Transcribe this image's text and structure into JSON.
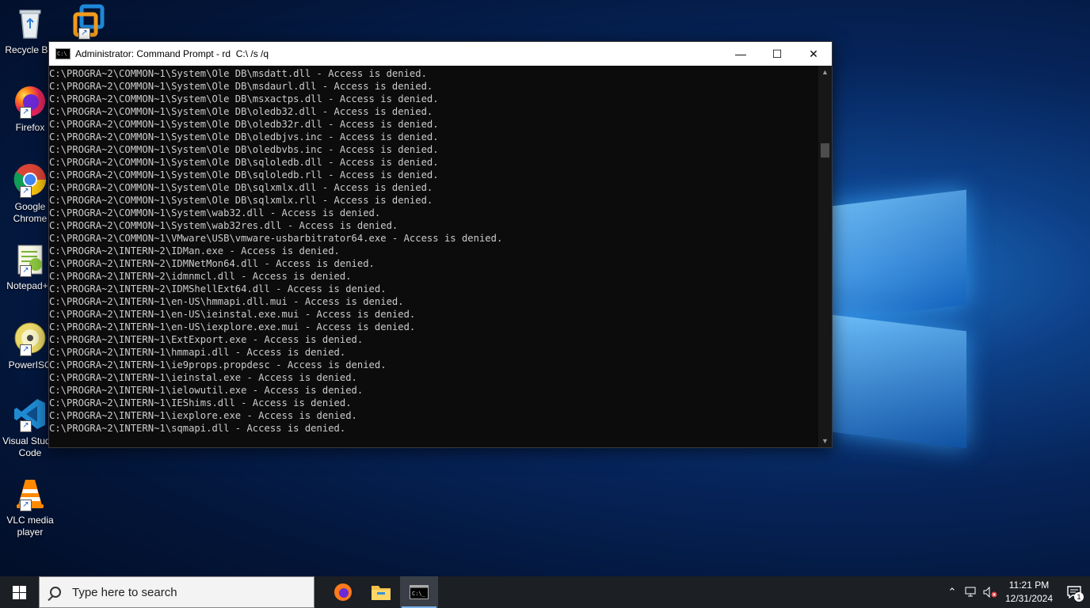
{
  "desktop": {
    "icons": [
      {
        "label": "Recycle Bin",
        "icon": "recycle-bin-icon"
      },
      {
        "label": "",
        "icon": "vmware-icon"
      },
      {
        "label": "Firefox",
        "icon": "firefox-icon"
      },
      {
        "label": "Google Chrome",
        "icon": "chrome-icon"
      },
      {
        "label": "Notepad++",
        "icon": "notepad-plus-plus-icon"
      },
      {
        "label": "PowerISO",
        "icon": "poweriso-icon"
      },
      {
        "label": "Visual Studio Code",
        "icon": "vscode-icon"
      },
      {
        "label": "VLC media player",
        "icon": "vlc-icon"
      }
    ]
  },
  "cmd": {
    "title": "Administrator: Command Prompt - rd  C:\\ /s /q",
    "minimize": "—",
    "maximize": "☐",
    "close": "✕",
    "lines": [
      "C:\\PROGRA~2\\COMMON~1\\System\\Ole DB\\msdatt.dll - Access is denied.",
      "C:\\PROGRA~2\\COMMON~1\\System\\Ole DB\\msdaurl.dll - Access is denied.",
      "C:\\PROGRA~2\\COMMON~1\\System\\Ole DB\\msxactps.dll - Access is denied.",
      "C:\\PROGRA~2\\COMMON~1\\System\\Ole DB\\oledb32.dll - Access is denied.",
      "C:\\PROGRA~2\\COMMON~1\\System\\Ole DB\\oledb32r.dll - Access is denied.",
      "C:\\PROGRA~2\\COMMON~1\\System\\Ole DB\\oledbjvs.inc - Access is denied.",
      "C:\\PROGRA~2\\COMMON~1\\System\\Ole DB\\oledbvbs.inc - Access is denied.",
      "C:\\PROGRA~2\\COMMON~1\\System\\Ole DB\\sqloledb.dll - Access is denied.",
      "C:\\PROGRA~2\\COMMON~1\\System\\Ole DB\\sqloledb.rll - Access is denied.",
      "C:\\PROGRA~2\\COMMON~1\\System\\Ole DB\\sqlxmlx.dll - Access is denied.",
      "C:\\PROGRA~2\\COMMON~1\\System\\Ole DB\\sqlxmlx.rll - Access is denied.",
      "C:\\PROGRA~2\\COMMON~1\\System\\wab32.dll - Access is denied.",
      "C:\\PROGRA~2\\COMMON~1\\System\\wab32res.dll - Access is denied.",
      "C:\\PROGRA~2\\COMMON~1\\VMware\\USB\\vmware-usbarbitrator64.exe - Access is denied.",
      "C:\\PROGRA~2\\INTERN~2\\IDMan.exe - Access is denied.",
      "C:\\PROGRA~2\\INTERN~2\\IDMNetMon64.dll - Access is denied.",
      "C:\\PROGRA~2\\INTERN~2\\idmnmcl.dll - Access is denied.",
      "C:\\PROGRA~2\\INTERN~2\\IDMShellExt64.dll - Access is denied.",
      "C:\\PROGRA~2\\INTERN~1\\en-US\\hmmapi.dll.mui - Access is denied.",
      "C:\\PROGRA~2\\INTERN~1\\en-US\\ieinstal.exe.mui - Access is denied.",
      "C:\\PROGRA~2\\INTERN~1\\en-US\\iexplore.exe.mui - Access is denied.",
      "C:\\PROGRA~2\\INTERN~1\\ExtExport.exe - Access is denied.",
      "C:\\PROGRA~2\\INTERN~1\\hmmapi.dll - Access is denied.",
      "C:\\PROGRA~2\\INTERN~1\\ie9props.propdesc - Access is denied.",
      "C:\\PROGRA~2\\INTERN~1\\ieinstal.exe - Access is denied.",
      "C:\\PROGRA~2\\INTERN~1\\ielowutil.exe - Access is denied.",
      "C:\\PROGRA~2\\INTERN~1\\IEShims.dll - Access is denied.",
      "C:\\PROGRA~2\\INTERN~1\\iexplore.exe - Access is denied.",
      "C:\\PROGRA~2\\INTERN~1\\sqmapi.dll - Access is denied."
    ]
  },
  "taskbar": {
    "search_placeholder": "Type here to search",
    "apps": [
      "firefox-icon",
      "file-explorer-icon",
      "command-prompt-icon"
    ],
    "clock_time": "11:21 PM",
    "clock_date": "12/31/2024",
    "notification_count": "1"
  },
  "colors": {
    "console_bg": "#0c0c0c",
    "console_text": "#cccccc",
    "taskbar_bg": "#1c1f24",
    "accent": "#7ab4ea"
  }
}
